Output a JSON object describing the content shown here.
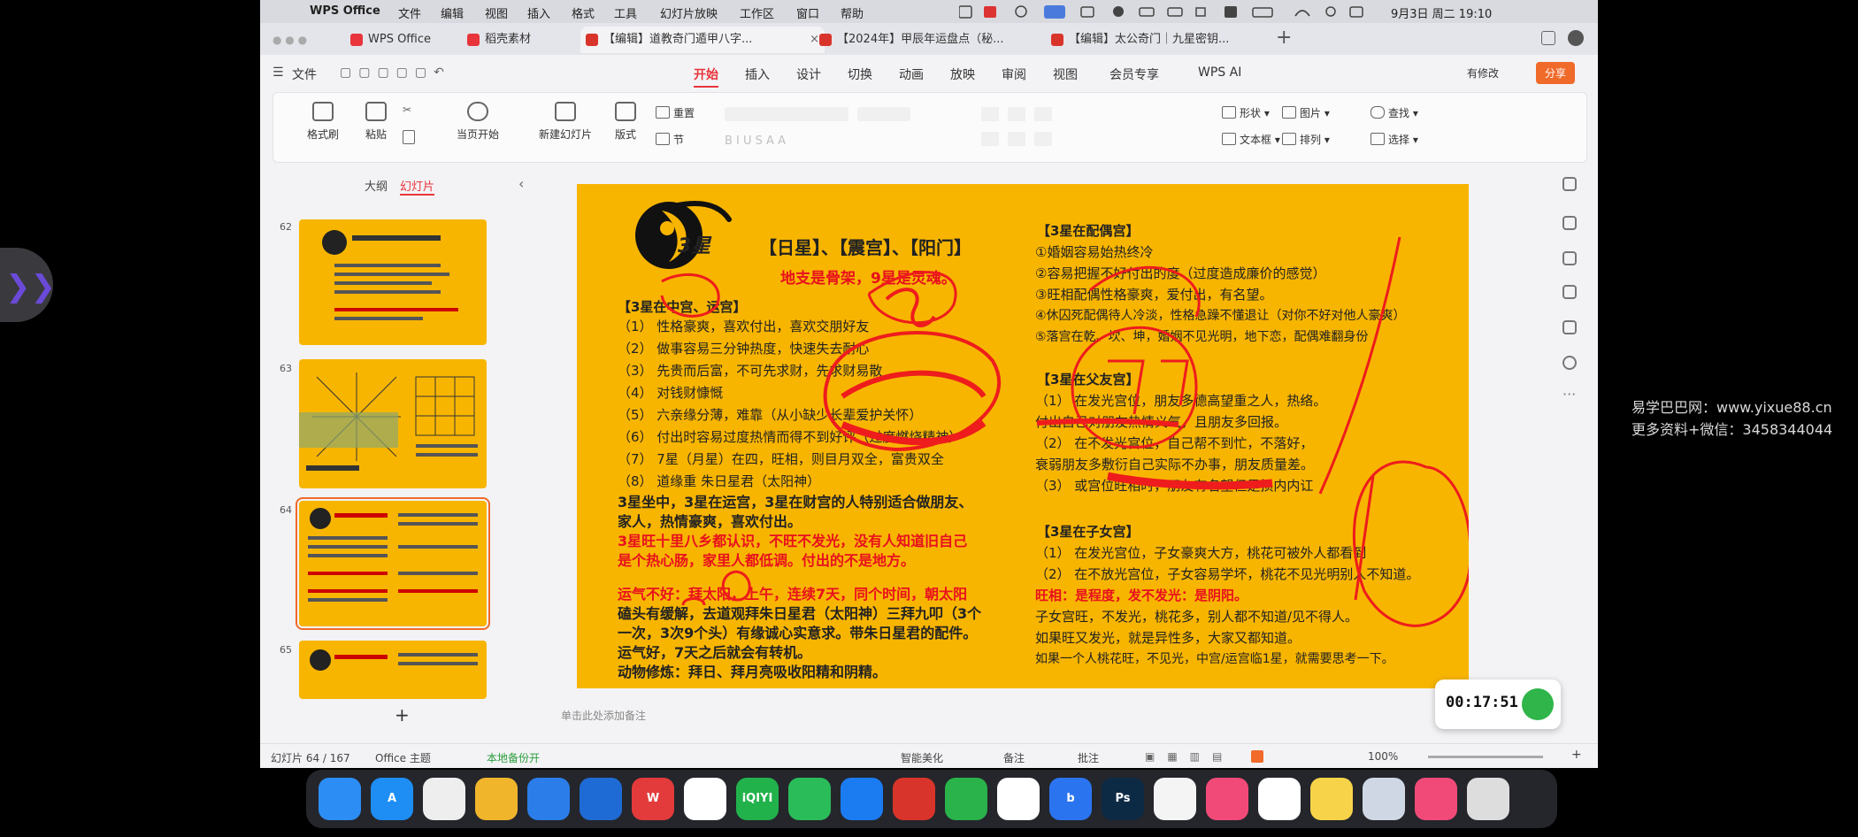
{
  "menubar": {
    "app_name": "WPS Office",
    "items": [
      "文件",
      "编辑",
      "视图",
      "插入",
      "格式",
      "工具",
      "幻灯片放映",
      "工作区",
      "窗口",
      "帮助"
    ],
    "clock": "9月3日 周二 19:10"
  },
  "tabs": [
    {
      "label": "WPS Office",
      "color": "#e8343b"
    },
    {
      "label": "稻壳素材",
      "color": "#e8343b"
    },
    {
      "label": "【编辑】道教奇门遁甲八字...",
      "color": "#d9342b"
    },
    {
      "label": "【2024年】甲辰年运盘点（秘...",
      "color": "#d9342b"
    },
    {
      "label": "【编辑】太公奇门｜九星密钥...",
      "color": "#d9342b"
    }
  ],
  "toolbar": {
    "file_label": "文件",
    "share_label": "分享",
    "modify_label": "有修改"
  },
  "ribbon_tabs": [
    "开始",
    "插入",
    "设计",
    "切换",
    "动画",
    "放映",
    "审阅",
    "视图",
    "会员专享",
    "WPS AI"
  ],
  "ribbon": {
    "format_painter": "格式刷",
    "paste": "粘贴",
    "start_from_current": "当页开始",
    "new_slide": "新建幻灯片",
    "layout": "版式",
    "reset": "重置",
    "section": "节",
    "shape": "形状",
    "picture": "图片",
    "textbox": "文本框",
    "arrange": "排列",
    "find": "查找",
    "select": "选择"
  },
  "sidebar": {
    "outline_tab": "大纲",
    "slides_tab": "幻灯片",
    "thumb_numbers": [
      "62",
      "63",
      "64",
      "65"
    ],
    "add_label": "+"
  },
  "slide": {
    "logo_text": "3星",
    "title": "【日星】、【震宫】、【阳门】",
    "subtitle": "地支是骨架，9星是灵魂。",
    "left_heading": "【3星在中宫、运宫】",
    "left_items": [
      "（1） 性格豪爽，喜欢付出，喜欢交朋好友",
      "（2） 做事容易三分钟热度，快速失去耐心",
      "（3） 先贵而后富，不可先求财，先求财易散",
      "（4） 对钱财慷慨",
      "（5） 六亲缘分薄，难靠（从小缺少长辈爱护关怀）",
      "（6） 付出时容易过度热情而得不到好评（过度燃烧精神）",
      "（7） 7星（月星）在四，旺相，则目月双全，富贵双全",
      "（8） 道缘重 朱日星君（太阳神）"
    ],
    "para1": [
      "3星坐中，3星在运宫，3星在财宫的人特别适合做朋友、",
      "家人，热情豪爽，喜欢付出。"
    ],
    "para2": [
      "3星旺十里八乡都认识，不旺不发光，没有人知道旧自己",
      "是个热心肠，家里人都低调。付出的不是地方。"
    ],
    "para3": [
      "运气不好：拜太阳，上午，连续7天，同个时间，朝太阳",
      "磕头有缓解，去道观拜朱日星君（太阳神）三拜九叩（3个",
      "一次，3次9个头）有缘诚心实意求。带朱日星君的配件。",
      "运气好，7天之后就会有转机。"
    ],
    "para4": "动物修炼：拜日、拜月亮吸收阳精和阴精。",
    "right_heading1": "【3星在配偶宫】",
    "right_items1": [
      "①婚姻容易始热终冷",
      "②容易把握不好付出的度（过度造成廉价的感觉）",
      "③旺相配偶性格豪爽，爱付出，有名望。",
      "④休囚死配偶待人冷淡，性格急躁不懂退让（对你不好对他人豪爽）",
      "⑤落宫在乾、坎、坤，婚姻不见光明，地下恋，配偶难翻身份"
    ],
    "right_heading2": "【3星在父友宫】",
    "right_items2": [
      "（1） 在发光宫位，朋友多德高望重之人，热络。",
      "        付出自己对朋友热情义气，且朋友多回报。",
      "（2） 在不发光宫位，自己帮不到忙，不落好，",
      "        衰弱朋友多敷衍自己实际不办事，朋友质量差。",
      "（3） 或宫位旺相时，朋友有名望但是损内内讧"
    ],
    "right_heading3": "【3星在子女宫】",
    "right_items3": [
      "（1） 在发光宫位，子女豪爽大方，桃花可被外人都看到",
      "（2） 在不放光宫位，子女容易学坏，桃花不见光明别人不知道。"
    ],
    "right_line_a": "旺相：是程度，发不发光：是阴阳。",
    "right_lines_b": [
      "子女宫旺，不发光，桃花多，别人都不知道/见不得人。",
      "如果旺又发光，就是异性多，大家又都知道。",
      "如果一个人桃花旺，不见光，中宫/运宫临1星，就需要思考一下。"
    ]
  },
  "notes": {
    "placeholder": "单击此处添加备注"
  },
  "status": {
    "slide_count": "幻灯片 64 / 167",
    "theme": "Office 主题",
    "backup": "本地备份开",
    "beautify": "智能美化",
    "notes": "备注",
    "comments": "批注",
    "zoom": "100%"
  },
  "timer": {
    "value": "00:17:51"
  },
  "dock": [
    {
      "label": "",
      "color": "#2c8df5"
    },
    {
      "label": "A",
      "color": "#1e8ef5"
    },
    {
      "label": "",
      "color": "#eeeeee"
    },
    {
      "label": "",
      "color": "#f1b52c"
    },
    {
      "label": "",
      "color": "#2b7de9"
    },
    {
      "label": "",
      "color": "#1f6bd6"
    },
    {
      "label": "W",
      "color": "#e33b3b"
    },
    {
      "label": "",
      "color": "#ffffff"
    },
    {
      "label": "iQIYI",
      "color": "#22b24c"
    },
    {
      "label": "",
      "color": "#2bbc5a"
    },
    {
      "label": "",
      "color": "#1b7cf2"
    },
    {
      "label": "",
      "color": "#d9342b"
    },
    {
      "label": "",
      "color": "#2ab24b"
    },
    {
      "label": "",
      "color": "#ffffff"
    },
    {
      "label": "b",
      "color": "#2b74f0"
    },
    {
      "label": "Ps",
      "color": "#0d2a45"
    },
    {
      "label": "",
      "color": "#f4f4f4"
    },
    {
      "label": "",
      "color": "#f24a78"
    },
    {
      "label": "",
      "color": "#ffffff"
    },
    {
      "label": "",
      "color": "#f7d34a"
    },
    {
      "label": "",
      "color": "#cfd7e4"
    },
    {
      "label": "",
      "color": "#f24a78"
    },
    {
      "label": "",
      "color": "#dddddd"
    }
  ],
  "watermark": {
    "line1": "易学巴巴网：www.yixue88.cn",
    "line2": "更多资料+微信：3458344044"
  }
}
